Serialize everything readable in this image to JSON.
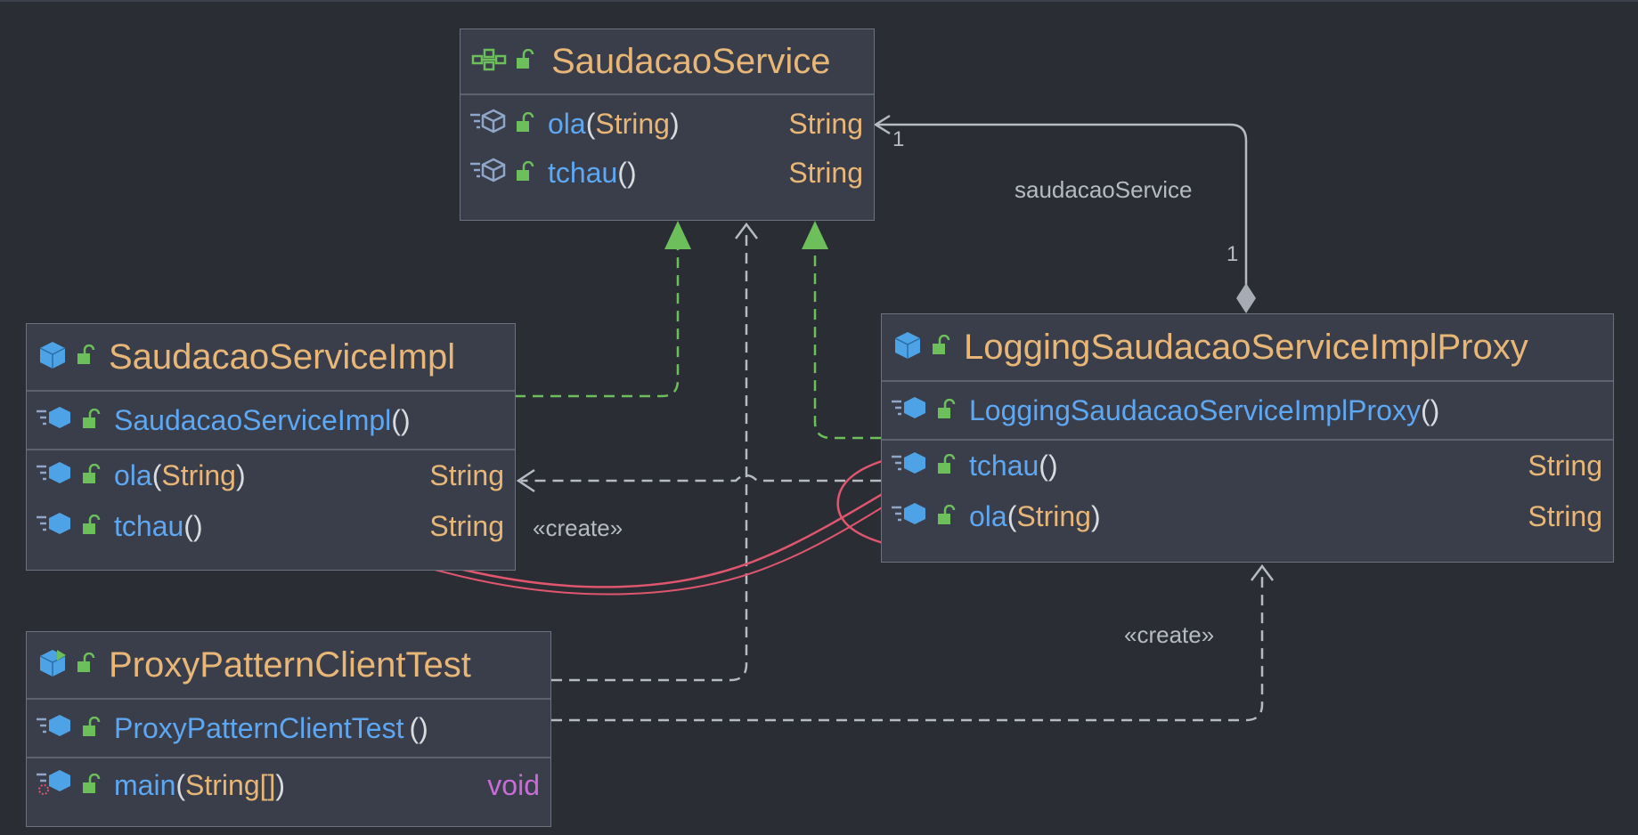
{
  "classes": {
    "saudacao_service": {
      "name": "SaudacaoService",
      "kind": "interface",
      "methods": [
        {
          "name": "ola",
          "params": "String",
          "ret": "String"
        },
        {
          "name": "tchau",
          "params": "",
          "ret": "String"
        }
      ]
    },
    "impl": {
      "name": "SaudacaoServiceImpl",
      "kind": "class",
      "constructor": "SaudacaoServiceImpl",
      "methods": [
        {
          "name": "ola",
          "params": "String",
          "ret": "String"
        },
        {
          "name": "tchau",
          "params": "",
          "ret": "String"
        }
      ]
    },
    "proxy": {
      "name": "LoggingSaudacaoServiceImplProxy",
      "kind": "class",
      "constructor": "LoggingSaudacaoServiceImplProxy",
      "methods": [
        {
          "name": "tchau",
          "params": "",
          "ret": "String"
        },
        {
          "name": "ola",
          "params": "String",
          "ret": "String"
        }
      ]
    },
    "client": {
      "name": "ProxyPatternClientTest",
      "kind": "test-class",
      "constructor": "ProxyPatternClientTest",
      "methods": [
        {
          "name": "main",
          "params": "String[]",
          "ret": "void"
        }
      ]
    }
  },
  "relations": {
    "field_label": "saudacaoService",
    "mult_source": "1",
    "mult_target": "1",
    "create_label_1": "«create»",
    "create_label_2": "«create»"
  },
  "punct": {
    "open": "(",
    "close": ")",
    "empty": "()"
  },
  "colors": {
    "background": "#2b2d34",
    "box": "#393e4a",
    "class_name": "#e8b677",
    "method_name": "#5ea7f2",
    "realization": "#6cbf5b",
    "dependency": "#b6bac2",
    "annotation": "#e0566f"
  }
}
